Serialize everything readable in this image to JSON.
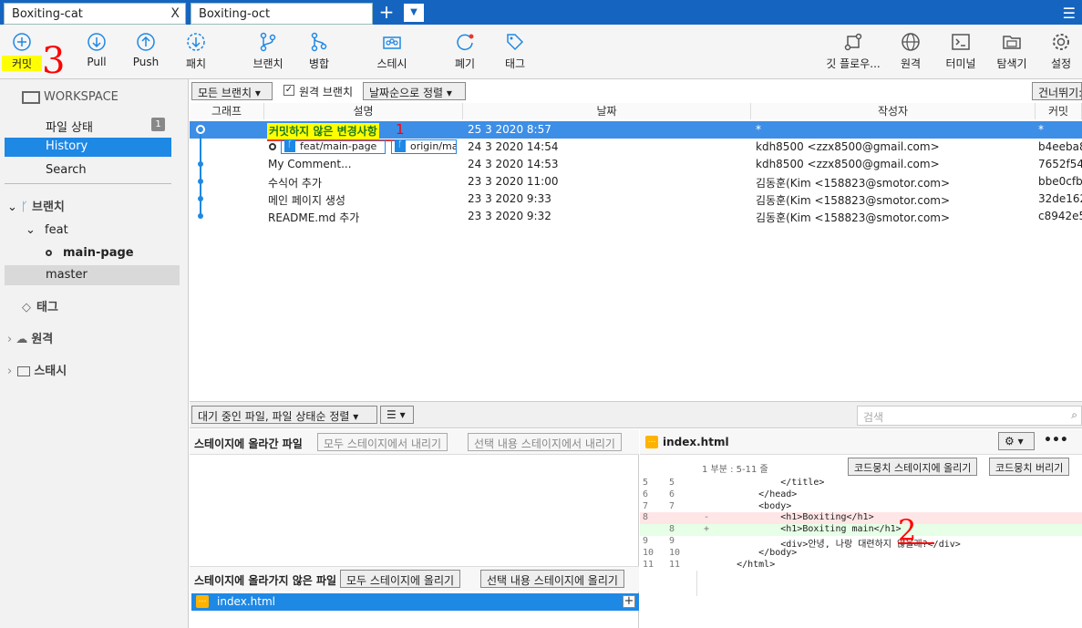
{
  "tabs": [
    {
      "label": "Boxiting-cat"
    },
    {
      "label": "Boxiting-oct"
    }
  ],
  "tab_close": "X",
  "toolbar": {
    "commit": "커밋",
    "pull": "Pull",
    "push": "Push",
    "fetch": "패치",
    "branch": "브랜치",
    "merge": "병합",
    "stash": "스테시",
    "discard": "폐기",
    "tag": "태그",
    "git_flow": "깃 플로우...",
    "remote": "원격",
    "terminal": "터미널",
    "explorer": "탐색기",
    "settings": "설정"
  },
  "sidebar": {
    "workspace": "WORKSPACE",
    "file_status": "파일 상태",
    "file_status_count": "1",
    "history": "History",
    "search": "Search",
    "branches": "브랜치",
    "feat": "feat",
    "main_page": "main-page",
    "master": "master",
    "tags": "태그",
    "remotes": "원격",
    "stashes": "스태시"
  },
  "filters": {
    "all_branches": "모든 브랜치",
    "remote_branches": "원격 브랜치",
    "sort_by_date": "날짜순으로 정렬",
    "jump_to": "건너뛰기:"
  },
  "columns": {
    "graph": "그래프",
    "description": "설명",
    "date": "날짜",
    "author": "작성자",
    "commit": "커밋"
  },
  "commits": [
    {
      "description": "커밋하지 않은 변경사항",
      "date": "25 3 2020 8:57",
      "author": "*",
      "hash": "*"
    },
    {
      "description": "",
      "branch1": "feat/main-page",
      "branch2": "origin/main-page",
      "date": "24 3 2020 14:54",
      "author": "kdh8500 <zzx8500@gmail.com>",
      "hash": "b4eeba8"
    },
    {
      "description": "My Comment...",
      "date": "24 3 2020 14:53",
      "author": "kdh8500 <zzx8500@gmail.com>",
      "hash": "7652f54"
    },
    {
      "description": "수식어 추가",
      "date": "23 3 2020 11:00",
      "author": "김동훈(Kim <158823@smotor.com>",
      "hash": "bbe0cfb"
    },
    {
      "description": "메인 페이지 생성",
      "date": "23 3 2020 9:33",
      "author": "김동훈(Kim <158823@smotor.com>",
      "hash": "32de162"
    },
    {
      "description": "README.md 추가",
      "date": "23 3 2020 9:32",
      "author": "김동훈(Kim <158823@smotor.com>",
      "hash": "c8942e5"
    }
  ],
  "bottom": {
    "pending_sort": "대기 중인 파일, 파일 상태순 정렬",
    "search_placeholder": "검색",
    "staged_title": "스테이지에 올라간 파일",
    "unstage_all": "모두 스테이지에서 내리기",
    "unstage_selected": "선택 내용 스테이지에서 내리기",
    "unstaged_title": "스테이지에 올라가지 않은 파일",
    "stage_all": "모두 스테이지에 올리기",
    "stage_selected": "선택 내용 스테이지에 올리기",
    "file": "index.html"
  },
  "diff": {
    "file": "index.html",
    "hunk": "1 부분 : 5-11 줄",
    "stage_hunk": "코드뭉치 스테이지에 올리기",
    "discard_hunk": "코드뭉치 버리기",
    "lines": [
      {
        "old": "5",
        "new": "5",
        "sign": "",
        "text": "            </title>",
        "type": "ctx"
      },
      {
        "old": "6",
        "new": "6",
        "sign": "",
        "text": "        </head>",
        "type": "ctx"
      },
      {
        "old": "7",
        "new": "7",
        "sign": "",
        "text": "        <body>",
        "type": "ctx"
      },
      {
        "old": "8",
        "new": "",
        "sign": "-",
        "text": "            <h1>Boxiting</h1>",
        "type": "del"
      },
      {
        "old": "",
        "new": "8",
        "sign": "+",
        "text": "            <h1>Boxiting main</h1>",
        "type": "add"
      },
      {
        "old": "9",
        "new": "9",
        "sign": "",
        "text": "            <div>안녕, 나랑 대련하지 않을래?</div>",
        "type": "ctx"
      },
      {
        "old": "10",
        "new": "10",
        "sign": "",
        "text": "        </body>",
        "type": "ctx"
      },
      {
        "old": "11",
        "new": "11",
        "sign": "",
        "text": "    </html>",
        "type": "ctx"
      }
    ]
  },
  "annotations": {
    "one": "1",
    "two": "2",
    "three": "3"
  },
  "colors": {
    "accent": "#1e88e5",
    "tabbar": "#1565c0",
    "highlight": "#ffff00",
    "mark": "#ff0000"
  }
}
